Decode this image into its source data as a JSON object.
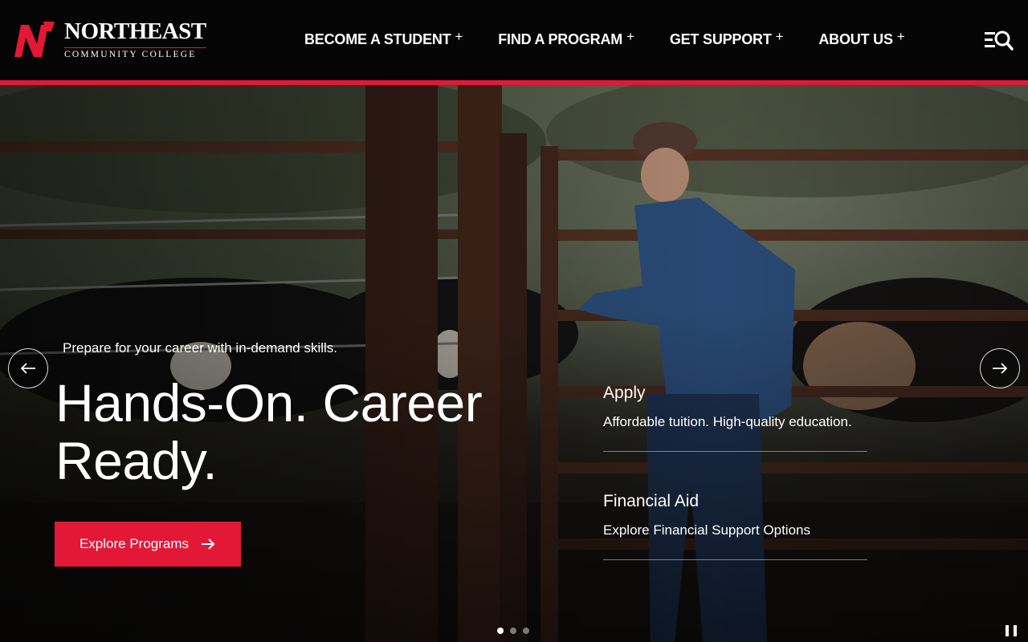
{
  "brand": {
    "name": "NORTHEAST",
    "subtitle": "COMMUNITY COLLEGE",
    "accent_color": "#e31837"
  },
  "nav": {
    "items": [
      {
        "label": "BECOME A STUDENT",
        "expander": "+"
      },
      {
        "label": "FIND A PROGRAM",
        "expander": "+"
      },
      {
        "label": "GET SUPPORT",
        "expander": "+"
      },
      {
        "label": "ABOUT US",
        "expander": "+"
      }
    ],
    "search_menu_icon": "menu-search-icon"
  },
  "hero": {
    "eyebrow": "Prepare for your career with in-demand skills.",
    "headline": "Hands-On. Career Ready.",
    "cta_label": "Explore Programs",
    "cta_icon": "arrow-right-icon",
    "prev_icon": "arrow-left-icon",
    "next_icon": "arrow-right-icon",
    "quick_links": [
      {
        "title": "Apply",
        "description": "Affordable tuition. High-quality education."
      },
      {
        "title": "Financial Aid",
        "description": "Explore Financial Support Options"
      }
    ],
    "slides": {
      "count": 3,
      "active": 1
    },
    "pause_icon": "pause-icon"
  }
}
